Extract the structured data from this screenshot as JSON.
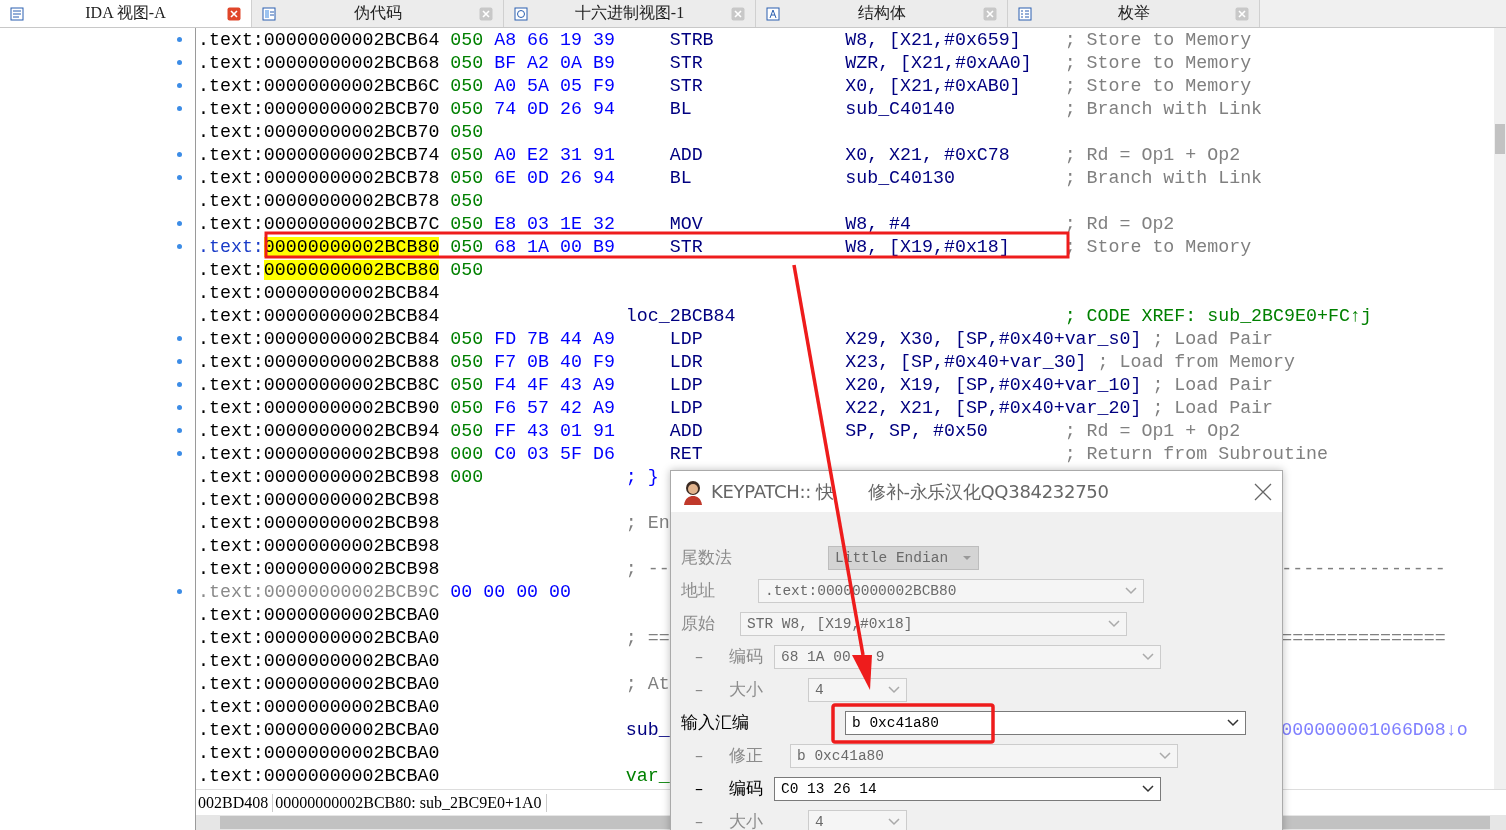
{
  "tabs": [
    {
      "label": "IDA 视图-A",
      "selected": true
    },
    {
      "label": "伪代码",
      "selected": false
    },
    {
      "label": "十六进制视图-1",
      "selected": false
    },
    {
      "label": "结构体",
      "selected": false
    },
    {
      "label": "枚举",
      "selected": false
    }
  ],
  "listing": [
    {
      "addr": ".text:00000000002BCB64",
      "prefix": "050",
      "bytes": "A8 66 19 39",
      "mnemonic": "STRB",
      "operands": "W8, [X21,#0x659]",
      "comment": "; Store to Memory",
      "marker": true
    },
    {
      "addr": ".text:00000000002BCB68",
      "prefix": "050",
      "bytes": "BF A2 0A B9",
      "mnemonic": "STR",
      "operands": "WZR, [X21,#0xAA0]",
      "comment": "; Store to Memory",
      "marker": true
    },
    {
      "addr": ".text:00000000002BCB6C",
      "prefix": "050",
      "bytes": "A0 5A 05 F9",
      "mnemonic": "STR",
      "operands": "X0, [X21,#0xAB0]",
      "comment": "; Store to Memory",
      "marker": true
    },
    {
      "addr": ".text:00000000002BCB70",
      "prefix": "050",
      "bytes": "74 0D 26 94",
      "mnemonic": "BL",
      "operands": "sub_C40140",
      "comment": "; Branch with Link",
      "marker": true
    },
    {
      "addr": ".text:00000000002BCB70",
      "prefix": "050",
      "marker": false
    },
    {
      "addr": ".text:00000000002BCB74",
      "prefix": "050",
      "bytes": "A0 E2 31 91",
      "mnemonic": "ADD",
      "operands": "X0, X21, #0xC78",
      "comment": "; Rd = Op1 + Op2",
      "marker": true
    },
    {
      "addr": ".text:00000000002BCB78",
      "prefix": "050",
      "bytes": "6E 0D 26 94",
      "mnemonic": "BL",
      "operands": "sub_C40130",
      "comment": "; Branch with Link",
      "marker": true
    },
    {
      "addr": ".text:00000000002BCB78",
      "prefix": "050",
      "marker": false
    },
    {
      "addr": ".text:00000000002BCB7C",
      "prefix": "050",
      "bytes": "E8 03 1E 32",
      "mnemonic": "MOV",
      "operands": "W8, #4",
      "comment": "; Rd = Op2",
      "marker": true
    },
    {
      "seg": ".text:",
      "offset": "00000000002BCB80",
      "highlighted": true,
      "current": true,
      "prefix": "050",
      "bytes": "68 1A 00 B9",
      "mnemonic": "STR",
      "operands": "W8, [X19,#0x18]",
      "comment": "; Store to Memory",
      "marker": true
    },
    {
      "seg": ".text:",
      "offset": "00000000002BCB80",
      "highlighted": true,
      "current": false,
      "prefix": "050",
      "marker": false
    },
    {
      "addr": ".text:00000000002BCB84",
      "marker": false
    },
    {
      "addr": ".text:00000000002BCB84",
      "label": {
        "text": "loc_2BCB84",
        "kind": "name"
      },
      "xref": "; CODE XREF: sub_2BC9E0+FC↑j",
      "marker": false
    },
    {
      "addr": ".text:00000000002BCB84",
      "prefix": "050",
      "bytes": "FD 7B 44 A9",
      "mnemonic": "LDP",
      "operands": "X29, X30, [SP,#0x40+var_s0]",
      "comment": "; Load Pair",
      "marker": true
    },
    {
      "addr": ".text:00000000002BCB88",
      "prefix": "050",
      "bytes": "F7 0B 40 F9",
      "mnemonic": "LDR",
      "operands": "X23, [SP,#0x40+var_30]",
      "comment": "; Load from Memory",
      "marker": true
    },
    {
      "addr": ".text:00000000002BCB8C",
      "prefix": "050",
      "bytes": "F4 4F 43 A9",
      "mnemonic": "LDP",
      "operands": "X20, X19, [SP,#0x40+var_10]",
      "comment": "; Load Pair",
      "marker": true
    },
    {
      "addr": ".text:00000000002BCB90",
      "prefix": "050",
      "bytes": "F6 57 42 A9",
      "mnemonic": "LDP",
      "operands": "X22, X21, [SP,#0x40+var_20]",
      "comment": "; Load Pair",
      "marker": true
    },
    {
      "addr": ".text:00000000002BCB94",
      "prefix": "050",
      "bytes": "FF 43 01 91",
      "mnemonic": "ADD",
      "operands": "SP, SP, #0x50",
      "comment": "; Rd = Op1 + Op2",
      "marker": true
    },
    {
      "addr": ".text:00000000002BCB98",
      "prefix": "000",
      "bytes": "C0 03 5F D6",
      "mnemonic": "RET",
      "comment": "; Return from Subroutine",
      "marker": true
    },
    {
      "addr": ".text:00000000002BCB98",
      "prefix": "000",
      "label": {
        "text": "; }",
        "kind": "brace"
      },
      "marker": false
    },
    {
      "addr": ".text:00000000002BCB98",
      "marker": false
    },
    {
      "addr": ".text:00000000002BCB98",
      "label": {
        "text": "; En",
        "kind": "comment"
      },
      "marker": false
    },
    {
      "addr": ".text:00000000002BCB98",
      "marker": false
    },
    {
      "addr": ".text:00000000002BCB98",
      "label": {
        "text": "; --",
        "kind": "comment"
      },
      "tail": {
        "text": "---------------",
        "kind": "comment"
      },
      "marker": false
    },
    {
      "addr": ".text:00000000002BCB9C",
      "dimmed": true,
      "data": "00 00 00 00",
      "marker": true
    },
    {
      "addr": ".text:00000000002BCBA0",
      "marker": false
    },
    {
      "addr": ".text:00000000002BCBA0",
      "label": {
        "text": "; ==",
        "kind": "comment"
      },
      "tail": {
        "text": "===============",
        "kind": "comment"
      },
      "marker": false
    },
    {
      "addr": ".text:00000000002BCBA0",
      "marker": false
    },
    {
      "addr": ".text:00000000002BCBA0",
      "label": {
        "text": "; At",
        "kind": "comment"
      },
      "marker": false
    },
    {
      "addr": ".text:00000000002BCBA0",
      "marker": false
    },
    {
      "addr": ".text:00000000002BCBA0",
      "label": {
        "text": "sub_",
        "kind": "name"
      },
      "tail": {
        "text": "000000001066D08↓o",
        "kind": "ref"
      },
      "marker": false
    },
    {
      "addr": ".text:00000000002BCBA0",
      "marker": false
    },
    {
      "addr": ".text:00000000002BCBA0",
      "label": {
        "text": "var_",
        "kind": "var"
      },
      "marker": false
    }
  ],
  "status_bar": [
    "002BD408",
    "00000000002BCB80: sub_2BC9E0+1A0"
  ],
  "dialog": {
    "title": [
      "KEYPATCH:: 快",
      "修补-永乐汉化QQ384232750"
    ],
    "rows": [
      {
        "label": "尾数法",
        "value": "Little Endian",
        "disabled": true,
        "kind": "select"
      },
      {
        "label": "地址",
        "value": ".text:00000000002BCB80",
        "disabled": true,
        "kind": "combo"
      },
      {
        "label": "原始",
        "value": "STR W8, [X19,#0x18]",
        "disabled": true,
        "kind": "combo"
      },
      {
        "dash": "–",
        "label": "编码",
        "value": [
          "68 1A 00",
          "9"
        ],
        "disabled": true,
        "kind": "combo"
      },
      {
        "dash": "–",
        "label": "大小",
        "value": "4",
        "disabled": true,
        "kind": "combo"
      },
      {
        "label": "输入汇编",
        "value": "b 0xc41a80",
        "disabled": false,
        "kind": "combo"
      },
      {
        "dash": "–",
        "label": "修正",
        "value": "b 0xc41a80",
        "disabled": true,
        "kind": "combo"
      },
      {
        "dash": "–",
        "label": "编码",
        "value": "C0 13 26 14",
        "disabled": false,
        "kind": "combo"
      },
      {
        "dash": "–",
        "label": "大小",
        "value": "4",
        "disabled": true,
        "kind": "combo"
      }
    ]
  }
}
